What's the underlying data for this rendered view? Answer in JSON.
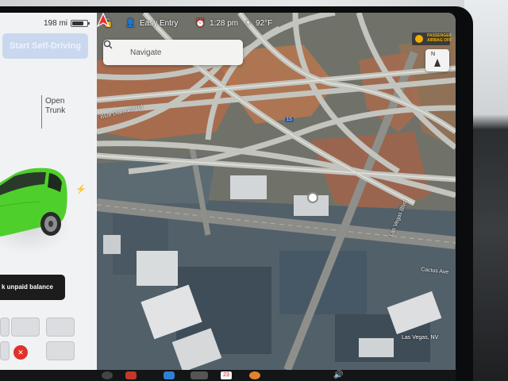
{
  "status": {
    "range": "198 mi",
    "battery_level": 0.75,
    "profile_name": "Easy Entry",
    "time": "1:28 pm",
    "temperature": "92°F"
  },
  "car_panel": {
    "self_driving_button": "Start Self-Driving",
    "trunk_label": "Open\nTrunk",
    "unpaid_banner": "k unpaid balance",
    "car_color": "#4fcf2b"
  },
  "search": {
    "placeholder": "Navigate"
  },
  "airbag": {
    "label": "PASSENGER AIRBAG OFF"
  },
  "compass": {
    "label": "N"
  },
  "map": {
    "location_label": "Las Vegas, NV",
    "road_labels": [
      "Blue Diamond Rd",
      "Las Vegas Blvd",
      "Cactus Ave"
    ]
  },
  "dock": {
    "calendar_day": "23",
    "volume_icon": "speaker-icon"
  },
  "colors": {
    "accent": "#c9d8ee",
    "nav_marker": "#e8302b",
    "mic_red": "#e0312b"
  }
}
